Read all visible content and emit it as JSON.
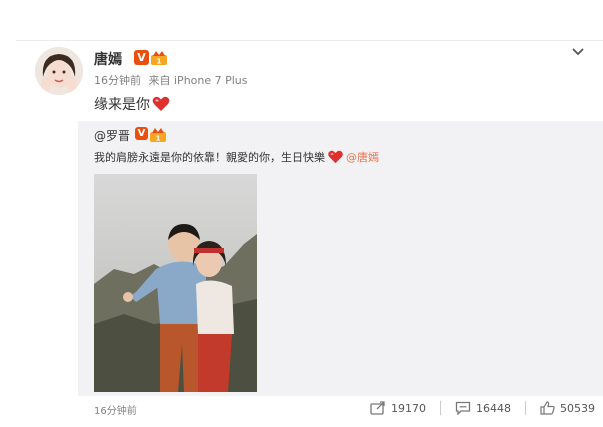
{
  "post": {
    "author": "唐嫣",
    "timestamp": "16分钟前",
    "source_prefix": "来自",
    "source_device": "iPhone 7 Plus",
    "content": "缘来是你"
  },
  "repost": {
    "author": "@罗晋",
    "text": "我的肩膀永遠是你的依靠！親愛的你，生日快樂",
    "mention": "@唐嫣",
    "timestamp": "16分钟前"
  },
  "stats": {
    "reposts": "19170",
    "comments": "16448",
    "likes": "50539"
  },
  "icons": {
    "verified": "v-badge-icon",
    "vip": "vip-crown-icon",
    "more": "chevron-down-icon",
    "heart": "heart-emoji-icon",
    "repost": "repost-icon",
    "comment": "comment-icon",
    "like": "thumbs-up-icon"
  },
  "colors": {
    "verified_badge": "#e94f0e",
    "mention": "#eb7350",
    "heart": "#e0302d",
    "repost_bg": "#f2f2f5"
  }
}
